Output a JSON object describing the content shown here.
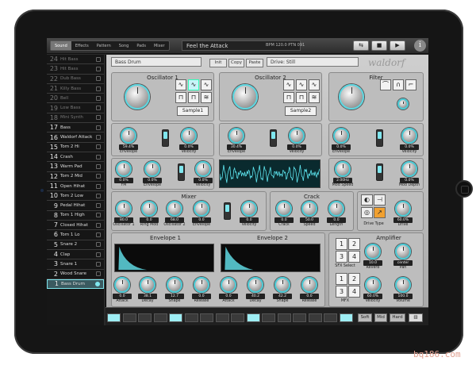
{
  "tabs": [
    "Sound",
    "Effects",
    "Pattern",
    "Song",
    "Pads",
    "Mixer"
  ],
  "active_tab": "Sound",
  "kit_name": "Feel the Attack",
  "bpm_label": "BPM 120.0",
  "pitch_label": "PTN 091",
  "sounds": [
    {
      "num": "24",
      "name": "Hit Bass",
      "dim": true
    },
    {
      "num": "23",
      "name": "Hit Bass",
      "dim": true
    },
    {
      "num": "22",
      "name": "Dub Bass",
      "dim": true
    },
    {
      "num": "21",
      "name": "Killy Bass",
      "dim": true
    },
    {
      "num": "20",
      "name": "Bell",
      "dim": true
    },
    {
      "num": "19",
      "name": "Low Bass",
      "dim": true
    },
    {
      "num": "18",
      "name": "Mini Synth",
      "dim": true
    },
    {
      "num": "17",
      "name": "Bass",
      "dim": false
    },
    {
      "num": "16",
      "name": "Waldorf Attack",
      "dim": false
    },
    {
      "num": "15",
      "name": "Tom 2 Hi",
      "dim": false
    },
    {
      "num": "14",
      "name": "Crash",
      "dim": false
    },
    {
      "num": "13",
      "name": "Warm Pad",
      "dim": false
    },
    {
      "num": "12",
      "name": "Tom 2 Mid",
      "dim": false
    },
    {
      "num": "11",
      "name": "Open Hihat",
      "dim": false
    },
    {
      "num": "10",
      "name": "Tom 2 Low",
      "dim": false
    },
    {
      "num": "9",
      "name": "Pedal Hihat",
      "dim": false
    },
    {
      "num": "8",
      "name": "Tom 1 High",
      "dim": false
    },
    {
      "num": "7",
      "name": "Closed Hihat",
      "dim": false
    },
    {
      "num": "6",
      "name": "Tom 1 Lo",
      "dim": false
    },
    {
      "num": "5",
      "name": "Snare 2",
      "dim": false
    },
    {
      "num": "4",
      "name": "Clap",
      "dim": false
    },
    {
      "num": "3",
      "name": "Snare 1",
      "dim": false
    },
    {
      "num": "2",
      "name": "Wood Snare",
      "dim": false
    },
    {
      "num": "1",
      "name": "Bass Drum",
      "dim": false,
      "selected": true
    }
  ],
  "sound_name": "Bass Drum",
  "buttons": {
    "init": "Init",
    "copy": "Copy",
    "paste": "Paste"
  },
  "drive_field": "Drive: Still",
  "logo": "waldorf",
  "osc1": {
    "title": "Oscillator 1",
    "sample": "Sample1"
  },
  "osc2": {
    "title": "Oscillator 2",
    "sample": "Sample2"
  },
  "filter": {
    "title": "Filter"
  },
  "mixer": {
    "title": "Mixer"
  },
  "crack": {
    "title": "Crack"
  },
  "amplifier": {
    "title": "Amplifier"
  },
  "env1": {
    "title": "Envelope 1"
  },
  "env2": {
    "title": "Envelope 2"
  },
  "knobs": {
    "osc1_env": {
      "val": "59.4%",
      "lab": "Envelope"
    },
    "osc1_vel": {
      "val": "0.0%",
      "lab": "Velocity"
    },
    "osc2_env": {
      "val": "30.4%",
      "lab": "Envelope"
    },
    "osc2_vel": {
      "val": "0.0%",
      "lab": "Velocity"
    },
    "flt_env": {
      "val": "0.0%",
      "lab": "Envelope"
    },
    "flt_vel": {
      "val": "0.0%",
      "lab": "Velocity"
    },
    "fm": {
      "val": "0.0%",
      "lab": "FM"
    },
    "fm_env": {
      "val": "0.0%",
      "lab": "Envelope"
    },
    "fm_vel": {
      "val": "0.0%",
      "lab": "Velocity"
    },
    "mod_speed": {
      "val": "2.00Hz",
      "lab": "Mod Speed"
    },
    "mod_depth": {
      "val": "0.0%",
      "lab": "Mod Depth"
    },
    "mx_osc1": {
      "val": "80.0",
      "lab": "Oscillator 1"
    },
    "mx_ring": {
      "val": "0.0",
      "lab": "Ring Mod"
    },
    "mx_osc2": {
      "val": "68.0",
      "lab": "Oscillator 2"
    },
    "mx_env": {
      "val": "0.0",
      "lab": "Envelope"
    },
    "mx_vel": {
      "val": "0.0",
      "lab": "Velocity"
    },
    "cr_crack": {
      "val": "0.0",
      "lab": "Crack"
    },
    "cr_speed": {
      "val": "50.0",
      "lab": "Speed"
    },
    "cr_length": {
      "val": "0.0",
      "lab": "Length"
    },
    "drive": {
      "val": "60.0%",
      "lab": "Drive"
    },
    "e1_attack": {
      "val": "0.0",
      "lab": "Attack"
    },
    "e1_decay": {
      "val": "38.1",
      "lab": "Decay"
    },
    "e1_shape": {
      "val": "12.7",
      "lab": "Shape"
    },
    "e1_release": {
      "val": "0.0",
      "lab": "Release"
    },
    "e2_attack": {
      "val": "0.0",
      "lab": "Attack"
    },
    "e2_decay": {
      "val": "40.2",
      "lab": "Decay"
    },
    "e2_shape": {
      "val": "42.2",
      "lab": "Shape"
    },
    "e2_release": {
      "val": "0.0",
      "lab": "Release"
    },
    "amp_reverb": {
      "val": "10.0",
      "lab": "Reverb"
    },
    "amp_pan": {
      "val": "center",
      "lab": "Pan"
    },
    "amp_vel": {
      "val": "60.0%",
      "lab": "Velocity"
    },
    "amp_vol": {
      "val": "100.0",
      "lab": "Volume"
    }
  },
  "drive_type_label": "Drive Type",
  "sfx_select": "SFX Select",
  "mfx": "MFX",
  "bottom": {
    "soft": "Soft",
    "mid": "Mid",
    "hard": "Hard"
  },
  "watermark": "bq186.com"
}
